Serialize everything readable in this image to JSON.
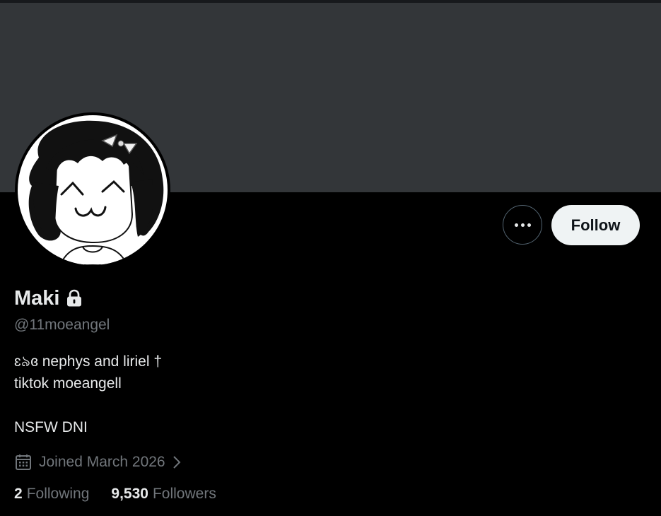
{
  "profile": {
    "display_name": "Maki",
    "handle": "@11moeangel",
    "bio_lines": [
      "ɛ৯ɞ nephys and liriel †",
      "tiktok moeangell",
      "",
      "NSFW DNI"
    ],
    "joined": "Joined March 2026",
    "protected_icon": "lock-icon",
    "avatar_icon": "avatar-drawing"
  },
  "actions": {
    "more_icon": "more-dots-icon",
    "follow_label": "Follow"
  },
  "stats": {
    "following_count": "2",
    "following_label": "Following",
    "followers_count": "9,530",
    "followers_label": "Followers"
  },
  "colors": {
    "background": "#000000",
    "banner": "#333639",
    "text_primary": "#e7e9ea",
    "text_secondary": "#71767b",
    "follow_button_bg": "#eff3f4"
  }
}
